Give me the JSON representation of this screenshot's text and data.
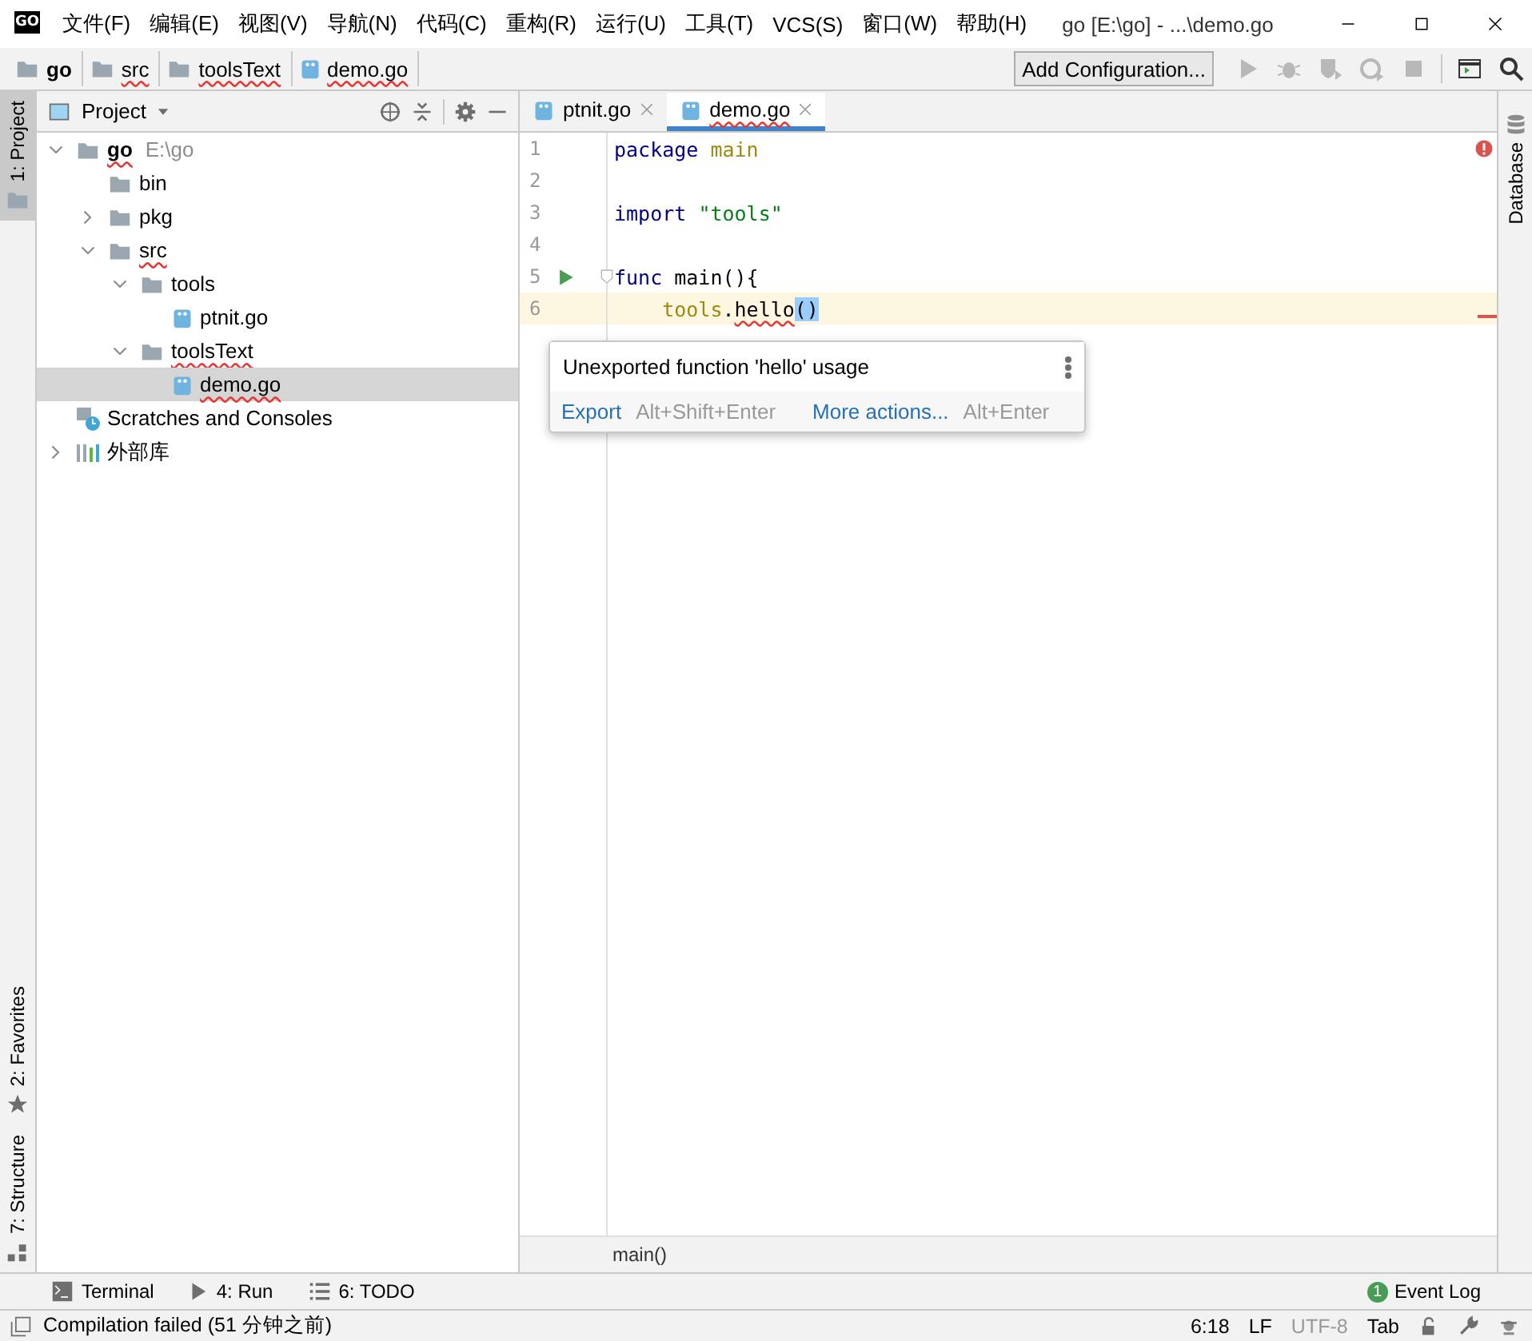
{
  "window": {
    "logo": "GO",
    "title": "go [E:\\go] - ...\\demo.go"
  },
  "menu": [
    "文件(F)",
    "编辑(E)",
    "视图(V)",
    "导航(N)",
    "代码(C)",
    "重构(R)",
    "运行(U)",
    "工具(T)",
    "VCS(S)",
    "窗口(W)",
    "帮助(H)"
  ],
  "breadcrumbs": [
    {
      "label": "go",
      "kind": "folder",
      "bold": true,
      "misspelled": false
    },
    {
      "label": "src",
      "kind": "folder",
      "bold": false,
      "misspelled": true
    },
    {
      "label": "toolsText",
      "kind": "folder",
      "bold": false,
      "misspelled": true
    },
    {
      "label": "demo.go",
      "kind": "gofile",
      "bold": false,
      "misspelled": true
    }
  ],
  "run_config_button": "Add Configuration...",
  "left_stripe": [
    {
      "label": "1: Project",
      "selected": true
    },
    {
      "label": "2: Favorites",
      "selected": false
    },
    {
      "label": "7: Structure",
      "selected": false
    }
  ],
  "right_stripe": [
    {
      "label": "Database"
    }
  ],
  "project": {
    "title": "Project",
    "tree": [
      {
        "label": "go",
        "hint": "E:\\go",
        "kind": "folder",
        "bold": true,
        "misspelled": true,
        "expanded": true,
        "selected": false,
        "children": [
          {
            "label": "bin",
            "kind": "folder",
            "selected": false
          },
          {
            "label": "pkg",
            "kind": "folder",
            "expanded": false,
            "selected": false
          },
          {
            "label": "src",
            "kind": "folder",
            "misspelled": true,
            "expanded": true,
            "selected": false,
            "children": [
              {
                "label": "tools",
                "kind": "folder",
                "expanded": true,
                "selected": false,
                "children": [
                  {
                    "label": "ptnit.go",
                    "kind": "gofile",
                    "selected": false
                  }
                ]
              },
              {
                "label": "toolsText",
                "kind": "folder",
                "misspelled": true,
                "expanded": true,
                "selected": false,
                "children": [
                  {
                    "label": "demo.go",
                    "kind": "gofile",
                    "misspelled": true,
                    "selected": true
                  }
                ]
              }
            ]
          }
        ]
      },
      {
        "label": "Scratches and Consoles",
        "kind": "scratch",
        "selected": false
      },
      {
        "label": "外部库",
        "kind": "library",
        "expanded": false,
        "selected": false
      }
    ]
  },
  "editor_tabs": [
    {
      "label": "ptnit.go",
      "selected": false,
      "misspelled": false
    },
    {
      "label": "demo.go",
      "selected": true,
      "misspelled": true
    }
  ],
  "code_lines": [
    {
      "number": "1",
      "current": false,
      "tokens": [
        {
          "text": "package",
          "kind": "keyword"
        },
        {
          "text": " main",
          "kind": "package"
        }
      ]
    },
    {
      "number": "2",
      "current": false
    },
    {
      "number": "3",
      "current": false,
      "tokens": [
        {
          "text": "import ",
          "kind": "keyword"
        },
        {
          "text": "\"tools\"",
          "kind": "string"
        }
      ]
    },
    {
      "number": "4",
      "current": false
    },
    {
      "number": "5",
      "current": false,
      "run": true,
      "fold": true,
      "tokens": [
        {
          "text": "func",
          "kind": "keyword"
        },
        {
          "text": " main(){",
          "kind": "plain"
        }
      ]
    },
    {
      "number": "6",
      "current": true,
      "tokens": [
        {
          "text": "    tools",
          "kind": "package"
        },
        {
          "text": ".",
          "kind": "plain"
        },
        {
          "text": "hello",
          "kind": "error"
        },
        {
          "text": "()",
          "kind": "matched"
        }
      ]
    }
  ],
  "popup": {
    "message": "Unexported function 'hello' usage",
    "actions": [
      {
        "label": "Export",
        "shortcut": "Alt+Shift+Enter"
      },
      {
        "label": "More actions...",
        "shortcut": "Alt+Enter"
      }
    ]
  },
  "editor_breadcrumb": "main()",
  "bottom_tools": [
    {
      "label": "Terminal",
      "kind": "terminal"
    },
    {
      "label": "4: Run",
      "kind": "run"
    },
    {
      "label": "6: TODO",
      "kind": "list"
    }
  ],
  "event_log": {
    "label": "Event Log",
    "count": "1"
  },
  "status": {
    "message": "Compilation failed (51 分钟之前)",
    "position": "6:18",
    "line_separator": "LF",
    "encoding": "UTF-8",
    "indent": "Tab"
  }
}
